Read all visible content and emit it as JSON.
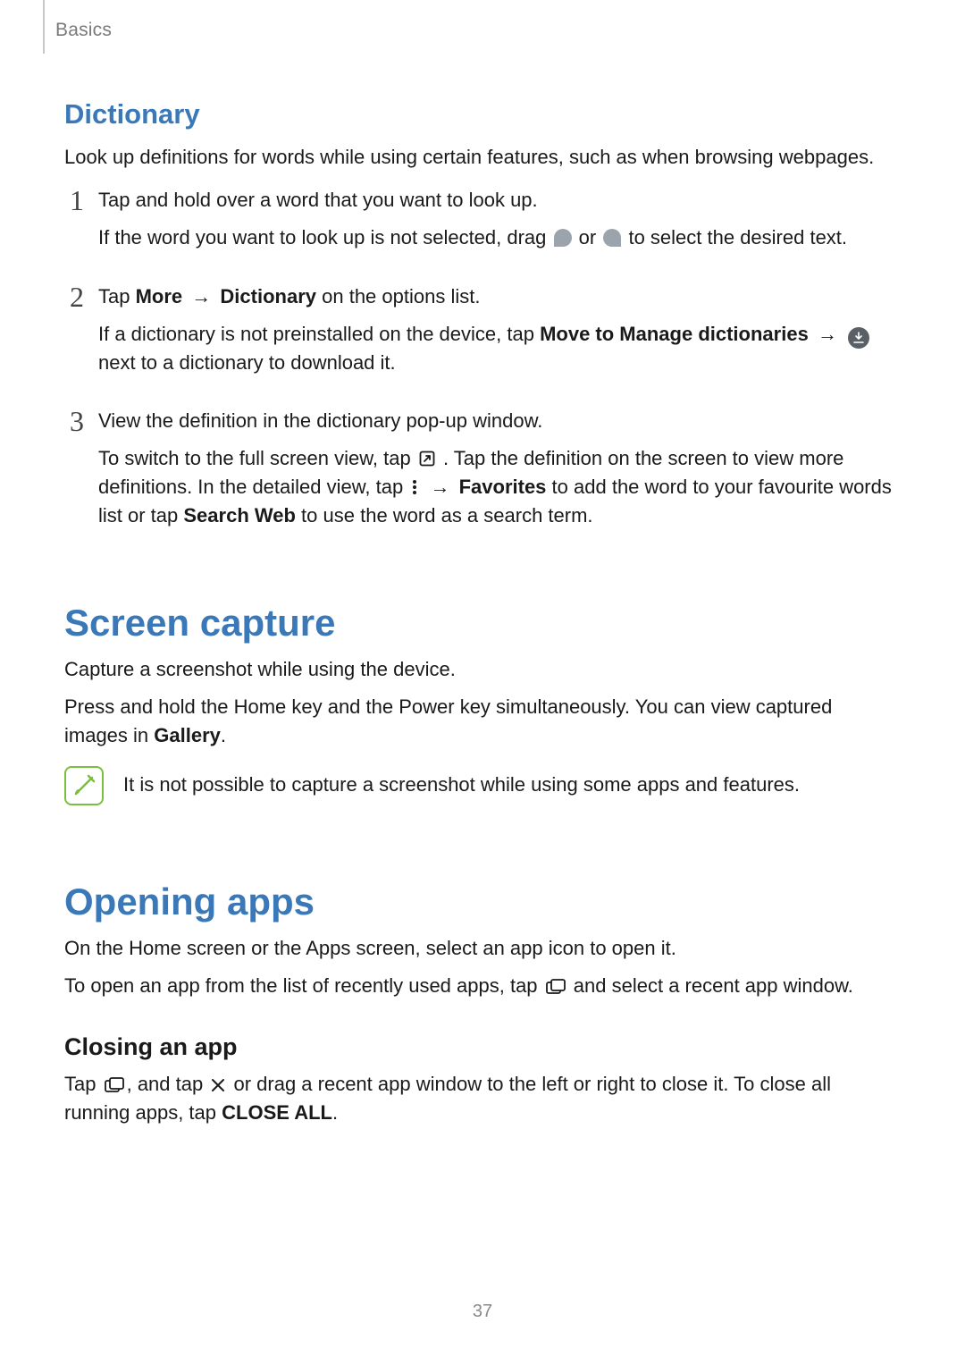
{
  "header": {
    "breadcrumb": "Basics"
  },
  "dictionary": {
    "title": "Dictionary",
    "intro": "Look up definitions for words while using certain features, such as when browsing webpages.",
    "steps": [
      {
        "n": "1",
        "line1": "Tap and hold over a word that you want to look up.",
        "line2_a": "If the word you want to look up is not selected, drag ",
        "line2_b": " or ",
        "line2_c": " to select the desired text."
      },
      {
        "n": "2",
        "line1_a": "Tap ",
        "line1_more": "More",
        "line1_arrow": " → ",
        "line1_dict": "Dictionary",
        "line1_b": " on the options list.",
        "line2_a": "If a dictionary is not preinstalled on the device, tap ",
        "line2_move": "Move to Manage dictionaries",
        "line2_arrow": " → ",
        "line2_b": " next to a dictionary to download it."
      },
      {
        "n": "3",
        "line1": "View the definition in the dictionary pop-up window.",
        "line2_a": "To switch to the full screen view, tap ",
        "line2_b": ". Tap the definition on the screen to view more definitions. In the detailed view, tap ",
        "line2_arrow": " → ",
        "line2_fav": "Favorites",
        "line2_c": " to add the word to your favourite words list or tap ",
        "line2_search": "Search Web",
        "line2_d": " to use the word as a search term."
      }
    ]
  },
  "screen_capture": {
    "title": "Screen capture",
    "p1": "Capture a screenshot while using the device.",
    "p2_a": "Press and hold the Home key and the Power key simultaneously. You can view captured images in ",
    "p2_gallery": "Gallery",
    "p2_b": ".",
    "note": "It is not possible to capture a screenshot while using some apps and features."
  },
  "opening_apps": {
    "title": "Opening apps",
    "p1": "On the Home screen or the Apps screen, select an app icon to open it.",
    "p2_a": "To open an app from the list of recently used apps, tap ",
    "p2_b": " and select a recent app window.",
    "closing_title": "Closing an app",
    "closing_a": "Tap ",
    "closing_b": ", and tap ",
    "closing_c": " or drag a recent app window to the left or right to close it. To close all running apps, tap ",
    "closing_closeall": "CLOSE ALL",
    "closing_d": "."
  },
  "footer": {
    "page_number": "37"
  }
}
